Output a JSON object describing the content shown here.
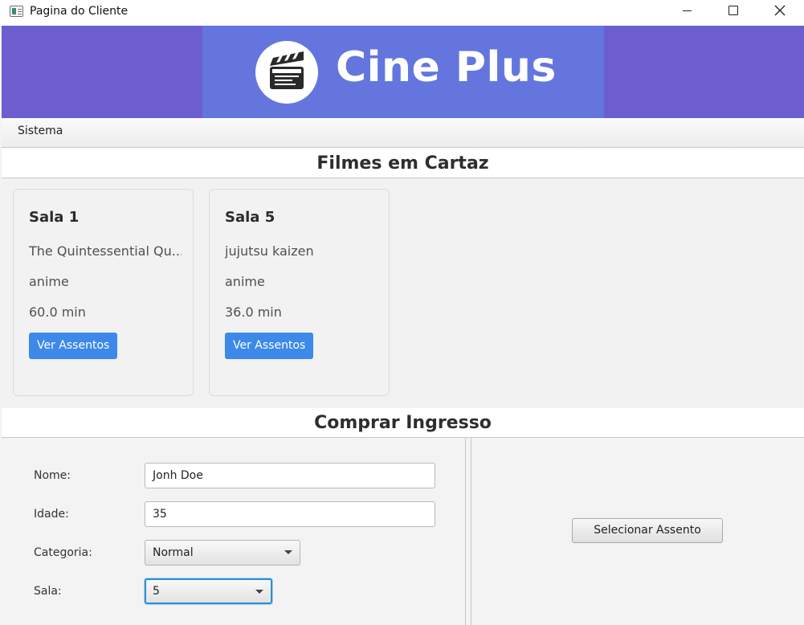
{
  "window": {
    "title": "Pagina do Cliente",
    "icon": "app-window-icon",
    "controls": [
      "minimize-icon",
      "maximize-icon",
      "close-icon"
    ]
  },
  "banner": {
    "brand": "Cine Plus",
    "logo_icon": "clapperboard-icon",
    "colors": {
      "outer": "#6c5ece",
      "center": "#6476de"
    }
  },
  "menubar": {
    "items": [
      "Sistema"
    ]
  },
  "sections": {
    "movies_title": "Filmes em Cartaz",
    "purchase_title": "Comprar Ingresso"
  },
  "movies": [
    {
      "room": "Sala 1",
      "title": "The Quintessential Qu...",
      "genre": "anime",
      "duration": "60.0 min",
      "button": "Ver Assentos"
    },
    {
      "room": "Sala 5",
      "title": "jujutsu kaizen",
      "genre": "anime",
      "duration": "36.0 min",
      "button": "Ver Assentos"
    }
  ],
  "form": {
    "name_label": "Nome:",
    "name_value": "Jonh Doe",
    "age_label": "Idade:",
    "age_value": "35",
    "category_label": "Categoria:",
    "category_value": "Normal",
    "room_label": "Sala:",
    "room_value": "5"
  },
  "seat_button": "Selecionar Assento",
  "accent_color": "#3d89ea"
}
